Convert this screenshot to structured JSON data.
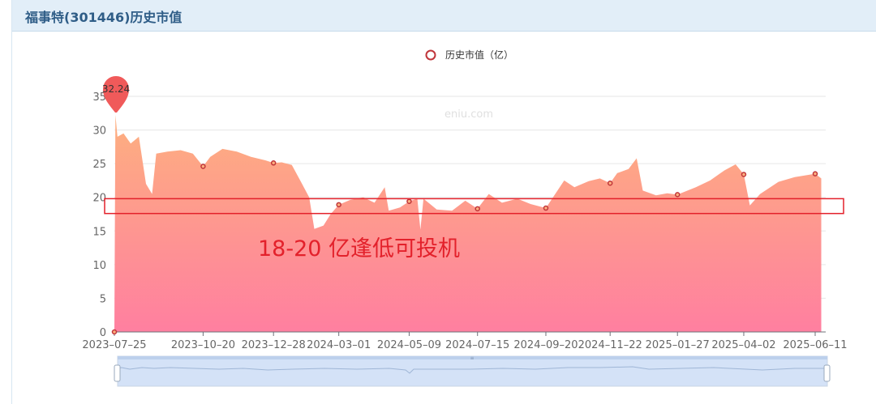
{
  "page": {
    "title": "福事特(301446)历史市值"
  },
  "watermark": "eniu.com",
  "annotation": {
    "text": "18-20 亿逢低可投机",
    "range": [
      17.6,
      19.8
    ],
    "color": "#e3212b"
  },
  "colors": {
    "area_top": "#fdb07f",
    "area_bottom": "#ff7fa0",
    "marker": "#c0353a",
    "pin": "#f05a5a"
  },
  "chart_data": {
    "type": "area",
    "legend": {
      "label": "历史市值（亿）",
      "position": "top-center"
    },
    "x_ticks": [
      "2023-07-25",
      "2023-10-20",
      "2023-12-28",
      "2024-03-01",
      "2024-05-09",
      "2024-07-15",
      "2024-09-20",
      "2024-11-22",
      "2025-01-27",
      "2025-04-02",
      "2025-06-11"
    ],
    "ylim": [
      0,
      35
    ],
    "y_ticks": [
      0,
      5,
      10,
      15,
      20,
      25,
      30,
      35
    ],
    "grid": "horizontal",
    "max_point": {
      "date": "2023-07-25",
      "value": 32.24
    },
    "series": [
      {
        "name": "历史市值（亿）",
        "points": [
          [
            "2023-07-25",
            0
          ],
          [
            "2023-07-26",
            32.24
          ],
          [
            "2023-07-28",
            29
          ],
          [
            "2023-08-03",
            29.5
          ],
          [
            "2023-08-10",
            28
          ],
          [
            "2023-08-18",
            29
          ],
          [
            "2023-08-25",
            22
          ],
          [
            "2023-08-31",
            20.5
          ],
          [
            "2023-09-04",
            26.5
          ],
          [
            "2023-09-15",
            26.8
          ],
          [
            "2023-09-28",
            27
          ],
          [
            "2023-10-10",
            26.5
          ],
          [
            "2023-10-20",
            24.6
          ],
          [
            "2023-10-27",
            26
          ],
          [
            "2023-11-08",
            27.2
          ],
          [
            "2023-11-22",
            26.8
          ],
          [
            "2023-12-06",
            26
          ],
          [
            "2023-12-20",
            25.5
          ],
          [
            "2023-12-28",
            25.1
          ],
          [
            "2024-01-05",
            25.2
          ],
          [
            "2024-01-15",
            24.8
          ],
          [
            "2024-01-25",
            22
          ],
          [
            "2024-02-01",
            20
          ],
          [
            "2024-02-06",
            15.3
          ],
          [
            "2024-02-15",
            15.8
          ],
          [
            "2024-02-22",
            17.5
          ],
          [
            "2024-03-01",
            18.9
          ],
          [
            "2024-03-12",
            19.6
          ],
          [
            "2024-03-25",
            20
          ],
          [
            "2024-04-05",
            19.2
          ],
          [
            "2024-04-15",
            21.5
          ],
          [
            "2024-04-19",
            18
          ],
          [
            "2024-04-30",
            18.5
          ],
          [
            "2024-05-09",
            19.4
          ],
          [
            "2024-05-17",
            19.8
          ],
          [
            "2024-05-20",
            15.2
          ],
          [
            "2024-05-23",
            19.8
          ],
          [
            "2024-06-05",
            18.2
          ],
          [
            "2024-06-20",
            18
          ],
          [
            "2024-07-03",
            19.5
          ],
          [
            "2024-07-15",
            18.3
          ],
          [
            "2024-07-26",
            20.5
          ],
          [
            "2024-08-08",
            19.2
          ],
          [
            "2024-08-23",
            19.8
          ],
          [
            "2024-09-05",
            19
          ],
          [
            "2024-09-20",
            18.4
          ],
          [
            "2024-10-08",
            22.5
          ],
          [
            "2024-10-18",
            21.5
          ],
          [
            "2024-11-01",
            22.4
          ],
          [
            "2024-11-12",
            22.8
          ],
          [
            "2024-11-22",
            22.1
          ],
          [
            "2024-11-29",
            23.6
          ],
          [
            "2024-12-10",
            24.2
          ],
          [
            "2024-12-18",
            25.8
          ],
          [
            "2024-12-24",
            21
          ],
          [
            "2025-01-06",
            20.3
          ],
          [
            "2025-01-17",
            20.6
          ],
          [
            "2025-01-27",
            20.4
          ],
          [
            "2025-02-14",
            21.5
          ],
          [
            "2025-02-28",
            22.5
          ],
          [
            "2025-03-14",
            24
          ],
          [
            "2025-03-25",
            24.9
          ],
          [
            "2025-04-02",
            23.4
          ],
          [
            "2025-04-08",
            18.8
          ],
          [
            "2025-04-18",
            20.5
          ],
          [
            "2025-05-06",
            22.3
          ],
          [
            "2025-05-22",
            23
          ],
          [
            "2025-06-11",
            23.5
          ],
          [
            "2025-06-17",
            22.8
          ]
        ],
        "markers": [
          [
            "2023-07-25",
            0
          ],
          [
            "2023-10-20",
            24.6
          ],
          [
            "2023-12-28",
            25.1
          ],
          [
            "2024-03-01",
            18.9
          ],
          [
            "2024-05-09",
            19.4
          ],
          [
            "2024-07-15",
            18.3
          ],
          [
            "2024-09-20",
            18.4
          ],
          [
            "2024-11-22",
            22.1
          ],
          [
            "2025-01-27",
            20.4
          ],
          [
            "2025-04-02",
            23.4
          ],
          [
            "2025-06-11",
            23.5
          ]
        ]
      }
    ]
  }
}
